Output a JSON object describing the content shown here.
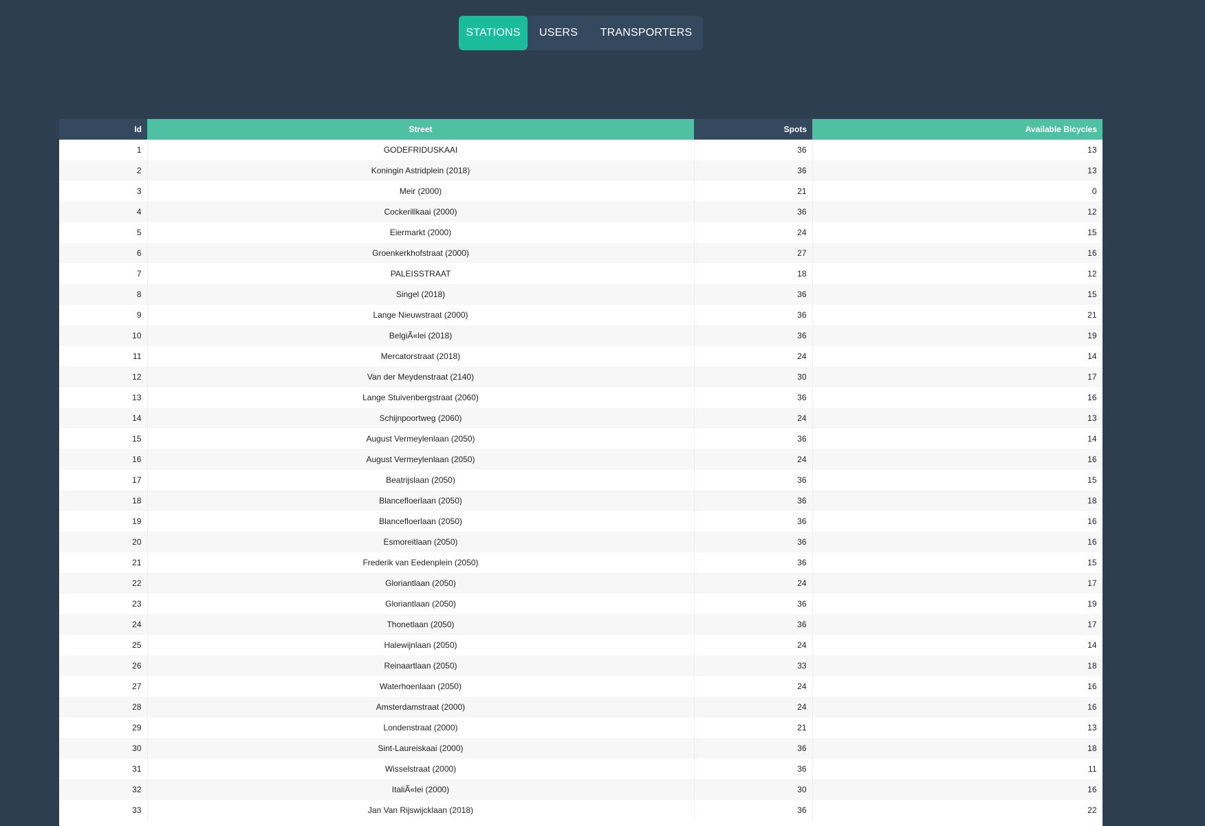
{
  "nav": {
    "tabs": [
      {
        "label": "STATIONS",
        "active": true
      },
      {
        "label": "USERS",
        "active": false
      },
      {
        "label": "TRANSPORTERS",
        "active": false
      }
    ]
  },
  "colors": {
    "background": "#2c3e50",
    "accent": "#1abc9c",
    "header_dark": "#34495e",
    "header_green": "#4fc1a2"
  },
  "table": {
    "headers": {
      "id": "Id",
      "street": "Street",
      "spots": "Spots",
      "available": "Available Bicycles"
    },
    "rows": [
      {
        "id": "1",
        "street": "GODEFRIDUSKAAI",
        "spots": "36",
        "available": "13"
      },
      {
        "id": "2",
        "street": "Koningin Astridplein (2018)",
        "spots": "36",
        "available": "13"
      },
      {
        "id": "3",
        "street": "Meir (2000)",
        "spots": "21",
        "available": "0"
      },
      {
        "id": "4",
        "street": "Cockerillkaai (2000)",
        "spots": "36",
        "available": "12"
      },
      {
        "id": "5",
        "street": "Eiermarkt (2000)",
        "spots": "24",
        "available": "15"
      },
      {
        "id": "6",
        "street": "Groenkerkhofstraat (2000)",
        "spots": "27",
        "available": "16"
      },
      {
        "id": "7",
        "street": "PALEISSTRAAT",
        "spots": "18",
        "available": "12"
      },
      {
        "id": "8",
        "street": "Singel (2018)",
        "spots": "36",
        "available": "15"
      },
      {
        "id": "9",
        "street": "Lange Nieuwstraat (2000)",
        "spots": "36",
        "available": "21"
      },
      {
        "id": "10",
        "street": "BelgiÃ«lei (2018)",
        "spots": "36",
        "available": "19"
      },
      {
        "id": "11",
        "street": "Mercatorstraat (2018)",
        "spots": "24",
        "available": "14"
      },
      {
        "id": "12",
        "street": "Van der Meydenstraat (2140)",
        "spots": "30",
        "available": "17"
      },
      {
        "id": "13",
        "street": "Lange Stuivenbergstraat (2060)",
        "spots": "36",
        "available": "16"
      },
      {
        "id": "14",
        "street": "Schijnpoortweg (2060)",
        "spots": "24",
        "available": "13"
      },
      {
        "id": "15",
        "street": "August Vermeylenlaan (2050)",
        "spots": "36",
        "available": "14"
      },
      {
        "id": "16",
        "street": "August Vermeylenlaan (2050)",
        "spots": "24",
        "available": "16"
      },
      {
        "id": "17",
        "street": "Beatrijslaan (2050)",
        "spots": "36",
        "available": "15"
      },
      {
        "id": "18",
        "street": "Blancefloerlaan (2050)",
        "spots": "36",
        "available": "18"
      },
      {
        "id": "19",
        "street": "Blancefloerlaan (2050)",
        "spots": "36",
        "available": "16"
      },
      {
        "id": "20",
        "street": "Esmoreitlaan (2050)",
        "spots": "36",
        "available": "16"
      },
      {
        "id": "21",
        "street": "Frederik van Eedenplein (2050)",
        "spots": "36",
        "available": "15"
      },
      {
        "id": "22",
        "street": "Gloriantlaan (2050)",
        "spots": "24",
        "available": "17"
      },
      {
        "id": "23",
        "street": "Gloriantlaan (2050)",
        "spots": "36",
        "available": "19"
      },
      {
        "id": "24",
        "street": "Thonetlaan (2050)",
        "spots": "36",
        "available": "17"
      },
      {
        "id": "25",
        "street": "Halewijnlaan (2050)",
        "spots": "24",
        "available": "14"
      },
      {
        "id": "26",
        "street": "Reinaartlaan (2050)",
        "spots": "33",
        "available": "18"
      },
      {
        "id": "27",
        "street": "Waterhoenlaan (2050)",
        "spots": "24",
        "available": "16"
      },
      {
        "id": "28",
        "street": "Amsterdamstraat (2000)",
        "spots": "24",
        "available": "16"
      },
      {
        "id": "29",
        "street": "Londenstraat (2000)",
        "spots": "21",
        "available": "13"
      },
      {
        "id": "30",
        "street": "Sint-Laureiskaai (2000)",
        "spots": "36",
        "available": "18"
      },
      {
        "id": "31",
        "street": "Wisselstraat (2000)",
        "spots": "36",
        "available": "11"
      },
      {
        "id": "32",
        "street": "ItaliÃ«lei (2000)",
        "spots": "30",
        "available": "16"
      },
      {
        "id": "33",
        "street": "Jan Van Rijswijcklaan (2018)",
        "spots": "36",
        "available": "22"
      }
    ]
  }
}
